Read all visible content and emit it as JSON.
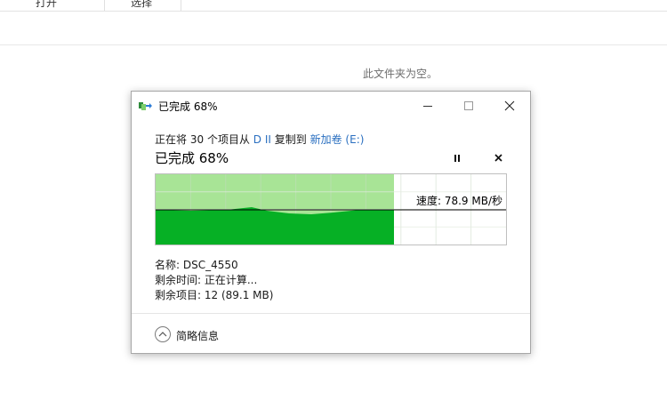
{
  "explorer": {
    "ribbon_tabs": [
      "打开",
      "选择"
    ],
    "empty_message": "此文件夹为空。"
  },
  "dialog": {
    "title": "已完成 68%",
    "icon": "copy-files-icon",
    "window_buttons": [
      "minimize-icon",
      "maximize-icon",
      "close-icon"
    ],
    "description": {
      "prefix": "正在将",
      "count": "30",
      "mid": "个项目从",
      "source": "D II",
      "verb": "复制到",
      "destination": "新加卷 (E:)"
    },
    "big_status": "已完成 68%",
    "progress": 0.68,
    "speed_label": "速度: 78.9 MB/秒",
    "controls": [
      "pause-icon",
      "stop-icon"
    ],
    "details": {
      "name": "名称: DSC_4550",
      "time_remaining": "剩余时间: 正在计算...",
      "items_remaining": "剩余项目: 12 (89.1 MB)"
    },
    "more_info": "简略信息",
    "colors": {
      "graph_fill": "#06b025",
      "graph_bg": "#a8e496",
      "link": "#2a6fc0"
    }
  }
}
